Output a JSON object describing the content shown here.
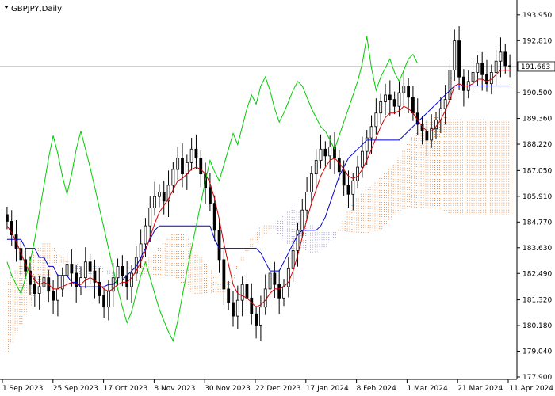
{
  "window": {
    "symbol_timeframe": "GBPJPY,Daily",
    "menu_icon": "triangle-down-icon"
  },
  "colors": {
    "background": "#ffffff",
    "candles": "#000000",
    "tenkan": "#cc0000",
    "kijun": "#0000cc",
    "chikou": "#00cc00",
    "cloud": "#e07020",
    "cloud_alt": "#8080c0",
    "price_line": "#a0a0a0",
    "grid_text": "#000000"
  },
  "current_price": "191.663",
  "chart_data": {
    "type": "candlestick-ichimoku",
    "ylim": [
      177.9,
      194.4
    ],
    "y_ticks": [
      "193.950",
      "192.810",
      "191.663",
      "190.500",
      "189.360",
      "188.220",
      "187.050",
      "185.910",
      "184.770",
      "183.630",
      "182.490",
      "181.320",
      "180.180",
      "179.040",
      "177.900"
    ],
    "x_ticks": [
      "1 Sep 2023",
      "25 Sep 2023",
      "17 Oct 2023",
      "8 Nov 2023",
      "30 Nov 2023",
      "22 Dec 2023",
      "17 Jan 2024",
      "8 Feb 2024",
      "1 Mar 2024",
      "21 Mar 2024",
      "11 Apr 2024"
    ],
    "closes": [
      184.8,
      184.2,
      183.6,
      183.1,
      182.6,
      182.0,
      181.6,
      181.9,
      182.3,
      181.7,
      181.3,
      181.8,
      182.4,
      182.9,
      182.5,
      181.9,
      182.3,
      183.0,
      182.6,
      182.1,
      181.5,
      181.0,
      181.7,
      182.3,
      182.8,
      182.4,
      181.9,
      182.5,
      183.2,
      183.8,
      184.6,
      185.4,
      185.9,
      186.1,
      185.7,
      186.4,
      187.1,
      187.6,
      186.9,
      187.4,
      188.0,
      187.6,
      186.9,
      186.3,
      185.6,
      184.4,
      183.1,
      181.8,
      181.2,
      180.6,
      181.3,
      182.0,
      181.4,
      180.7,
      180.2,
      181.0,
      181.8,
      182.5,
      182.0,
      181.4,
      181.9,
      182.7,
      183.5,
      184.4,
      185.3,
      186.1,
      186.9,
      187.5,
      188.0,
      187.7,
      188.1,
      187.6,
      187.0,
      186.4,
      186.0,
      186.6,
      187.2,
      187.9,
      188.5,
      189.0,
      189.6,
      190.1,
      190.4,
      190.2,
      189.9,
      190.5,
      190.8,
      190.3,
      189.6,
      189.1,
      188.8,
      188.4,
      188.9,
      189.3,
      189.8,
      190.2,
      191.5,
      192.8,
      191.2,
      190.6,
      191.0,
      191.4,
      191.8,
      191.3,
      190.9,
      191.4,
      191.9,
      192.3,
      191.7,
      191.663
    ],
    "tenkan": [
      184.6,
      184.3,
      183.9,
      183.4,
      182.9,
      182.5,
      182.2,
      182.0,
      182.1,
      182.0,
      181.8,
      181.8,
      181.9,
      182.0,
      182.1,
      182.0,
      182.0,
      182.2,
      182.3,
      182.2,
      182.0,
      181.8,
      181.7,
      181.8,
      182.0,
      182.1,
      182.1,
      182.3,
      182.6,
      183.0,
      183.5,
      184.1,
      184.7,
      185.2,
      185.5,
      185.8,
      186.2,
      186.6,
      186.7,
      186.9,
      187.1,
      187.2,
      187.1,
      186.9,
      186.5,
      185.8,
      184.9,
      183.8,
      182.9,
      182.0,
      181.6,
      181.5,
      181.4,
      181.2,
      181.0,
      181.1,
      181.3,
      181.6,
      181.8,
      181.8,
      181.9,
      182.1,
      182.6,
      183.3,
      184.1,
      184.9,
      185.6,
      186.2,
      186.8,
      187.2,
      187.5,
      187.6,
      187.4,
      187.1,
      186.8,
      186.7,
      186.8,
      187.1,
      187.5,
      188.0,
      188.5,
      189.0,
      189.4,
      189.6,
      189.6,
      189.7,
      189.9,
      189.8,
      189.6,
      189.3,
      189.0,
      188.8,
      188.8,
      189.0,
      189.3,
      189.7,
      190.2,
      190.8,
      190.9,
      190.8,
      190.8,
      190.9,
      191.1,
      191.1,
      191.0,
      191.1,
      191.3,
      191.5,
      191.5,
      191.5
    ],
    "kijun": [
      184.0,
      184.0,
      184.0,
      184.0,
      183.6,
      183.6,
      183.6,
      183.2,
      183.2,
      182.8,
      182.8,
      182.4,
      182.4,
      182.4,
      182.1,
      182.1,
      181.9,
      181.9,
      181.9,
      181.9,
      181.9,
      181.9,
      182.0,
      182.0,
      182.2,
      182.2,
      182.4,
      182.6,
      182.8,
      183.2,
      183.6,
      184.0,
      184.4,
      184.6,
      184.6,
      184.6,
      184.6,
      184.6,
      184.6,
      184.6,
      184.6,
      184.6,
      184.6,
      184.6,
      184.6,
      184.0,
      183.6,
      183.6,
      183.6,
      183.6,
      183.6,
      183.6,
      183.6,
      183.6,
      183.6,
      183.4,
      183.0,
      182.6,
      182.6,
      182.6,
      183.0,
      183.4,
      183.8,
      184.2,
      184.4,
      184.4,
      184.4,
      184.4,
      184.6,
      185.0,
      185.6,
      186.2,
      186.8,
      187.2,
      187.6,
      187.8,
      188.0,
      188.2,
      188.4,
      188.4,
      188.4,
      188.4,
      188.4,
      188.4,
      188.4,
      188.4,
      188.6,
      188.8,
      189.0,
      189.2,
      189.4,
      189.6,
      189.8,
      190.0,
      190.2,
      190.4,
      190.6,
      190.8,
      190.8,
      190.8,
      190.8,
      190.8,
      190.8,
      190.8,
      190.8,
      190.8,
      190.8,
      190.8,
      190.8,
      190.8
    ],
    "chikou": [
      183.0,
      182.4,
      182.0,
      181.6,
      182.3,
      183.0,
      184.0,
      185.2,
      186.4,
      187.6,
      188.6,
      187.8,
      186.8,
      186.0,
      186.9,
      188.0,
      188.8,
      188.0,
      187.2,
      186.3,
      185.4,
      184.5,
      183.6,
      182.7,
      181.8,
      181.0,
      180.3,
      180.8,
      181.6,
      182.4,
      183.0,
      182.3,
      181.6,
      180.9,
      180.4,
      179.9,
      179.5,
      180.4,
      181.5,
      182.6,
      183.6,
      184.6,
      185.6,
      186.6,
      187.5,
      187.0,
      186.6,
      187.3,
      188.0,
      188.7,
      188.2,
      189.0,
      189.8,
      190.4,
      190.0,
      190.8,
      191.2,
      190.6,
      189.8,
      189.2,
      189.6,
      190.1,
      190.6,
      191.0,
      190.8,
      190.3,
      189.8,
      189.4,
      189.0,
      188.8,
      188.4,
      188.0,
      188.6,
      189.2,
      189.8,
      190.4,
      191.0,
      191.8,
      193.0,
      191.6,
      190.6,
      191.2,
      191.6,
      192.0,
      191.4,
      191.0,
      191.5,
      192.0,
      192.2,
      191.8
    ],
    "cloud_a": [
      182.2,
      182.4,
      182.6,
      182.8,
      183.0,
      183.2,
      183.4,
      183.6,
      183.8,
      183.8,
      183.6,
      183.4,
      183.2,
      183.0,
      182.8,
      182.6,
      182.4,
      182.4,
      182.4,
      182.5,
      182.6,
      182.5,
      182.4,
      182.3,
      182.2,
      182.2,
      182.3,
      182.4,
      182.6,
      182.8,
      183.0,
      183.2,
      183.4,
      183.6,
      183.8,
      184.0,
      184.2,
      184.2,
      184.2,
      184.0,
      183.8,
      183.4,
      183.2,
      182.9,
      182.6,
      182.3,
      182.0,
      181.9,
      182.1,
      182.4,
      182.8,
      183.2,
      183.6,
      184.0,
      184.3,
      184.5,
      184.6,
      184.6,
      184.4,
      184.2,
      184.0,
      183.8,
      183.6,
      183.6,
      183.6,
      183.5,
      183.4,
      183.4,
      183.5,
      183.6,
      183.8,
      184.0,
      184.4,
      184.8,
      185.2,
      185.5,
      185.8,
      186.0,
      186.2,
      186.3,
      186.5,
      186.7,
      186.9,
      187.1,
      187.3,
      187.6,
      187.9,
      188.2,
      188.5,
      188.8,
      189.0,
      189.2,
      189.3,
      189.4,
      189.4,
      189.4,
      189.3,
      189.3,
      189.3,
      189.2,
      189.2,
      189.3,
      189.3,
      189.3,
      189.2,
      189.2,
      189.2,
      189.2,
      189.2,
      189.2
    ],
    "cloud_b": [
      179.0,
      179.4,
      179.8,
      180.2,
      180.6,
      181.0,
      181.4,
      181.8,
      182.2,
      182.4,
      182.6,
      182.8,
      182.9,
      182.9,
      182.9,
      182.9,
      182.8,
      182.8,
      182.8,
      182.8,
      182.8,
      182.7,
      182.6,
      182.5,
      182.4,
      182.4,
      182.4,
      182.4,
      182.4,
      182.4,
      182.4,
      182.4,
      182.4,
      182.4,
      182.4,
      182.4,
      182.4,
      182.2,
      182.0,
      181.8,
      181.6,
      181.6,
      181.6,
      181.6,
      181.6,
      181.6,
      181.6,
      181.6,
      181.8,
      182.2,
      182.6,
      183.0,
      183.3,
      183.6,
      183.8,
      184.0,
      184.2,
      184.4,
      184.6,
      184.8,
      185.0,
      185.2,
      185.4,
      185.2,
      185.0,
      184.8,
      184.6,
      184.4,
      184.3,
      184.3,
      184.3,
      184.3,
      184.3,
      184.3,
      184.3,
      184.3,
      184.3,
      184.3,
      184.3,
      184.3,
      184.3,
      184.4,
      184.6,
      184.8,
      185.0,
      185.2,
      185.3,
      185.4,
      185.4,
      185.4,
      185.4,
      185.4,
      185.4,
      185.4,
      185.3,
      185.2,
      185.1,
      185.0,
      185.0,
      185.0,
      185.0,
      185.0,
      185.0,
      185.0,
      185.0,
      185.0,
      185.0,
      185.0,
      185.0,
      185.0
    ]
  }
}
